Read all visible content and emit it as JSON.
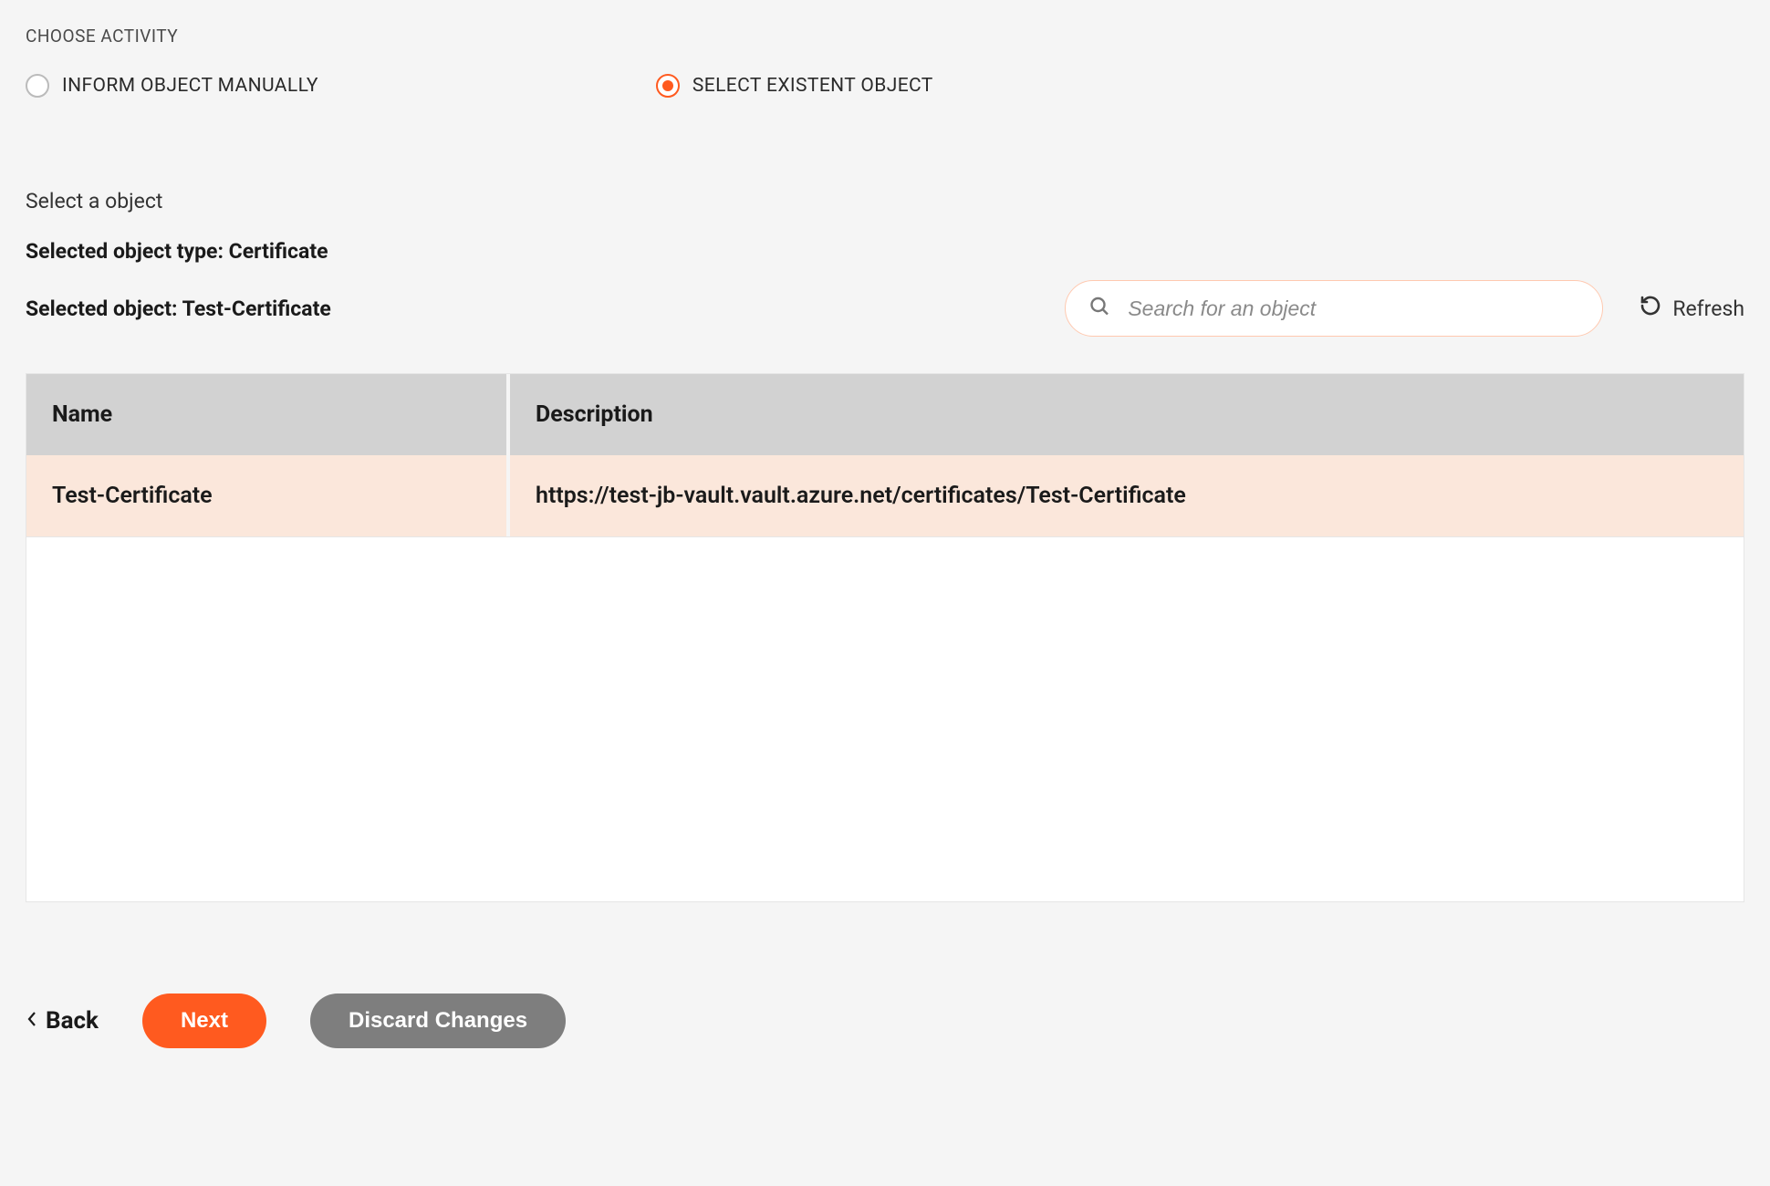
{
  "activity": {
    "section_label": "CHOOSE ACTIVITY",
    "options": [
      {
        "label": "INFORM OBJECT MANUALLY",
        "selected": false
      },
      {
        "label": "SELECT EXISTENT OBJECT",
        "selected": true
      }
    ]
  },
  "object_select": {
    "prompt": "Select a object",
    "type_prefix": "Selected object type: ",
    "type_value": "Certificate",
    "selected_prefix": "Selected object: ",
    "selected_value": "Test-Certificate"
  },
  "search": {
    "placeholder": "Search for an object"
  },
  "refresh_label": "Refresh",
  "table": {
    "headers": {
      "name": "Name",
      "description": "Description"
    },
    "rows": [
      {
        "name": "Test-Certificate",
        "description": "https://test-jb-vault.vault.azure.net/certificates/Test-Certificate",
        "selected": true
      }
    ]
  },
  "footer": {
    "back": "Back",
    "next": "Next",
    "discard": "Discard Changes"
  }
}
